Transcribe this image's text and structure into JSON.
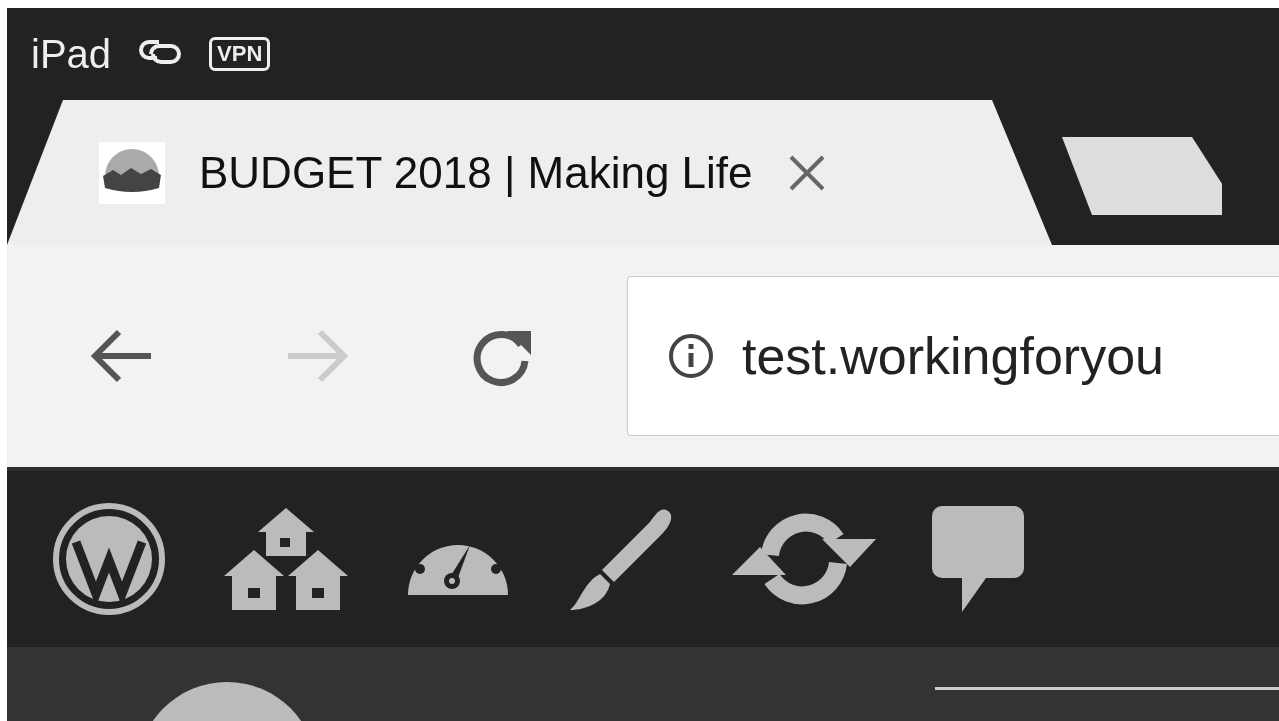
{
  "status_bar": {
    "device": "iPad",
    "vpn_badge": "VPN"
  },
  "tabs": [
    {
      "kind": "page",
      "title": "BUDGET 2018 | Making Life",
      "selected": true
    },
    {
      "kind": "new",
      "selected": false
    }
  ],
  "toolbar": {
    "back": {
      "disabled": false
    },
    "forward": {
      "disabled": true
    },
    "address": {
      "value": "test.workingforyou"
    }
  },
  "admin_bar": {
    "items": [
      {
        "kind": "logo"
      },
      {
        "kind": "sites"
      },
      {
        "kind": "dashboard"
      },
      {
        "kind": "brush"
      },
      {
        "kind": "updates"
      },
      {
        "kind": "comments"
      }
    ]
  }
}
